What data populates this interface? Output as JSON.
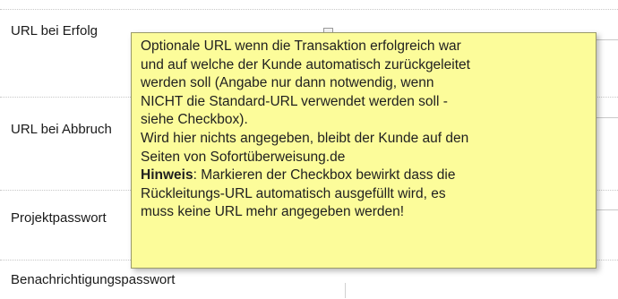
{
  "form": {
    "rows": [
      {
        "label": "URL bei Erfolg"
      },
      {
        "label": "URL bei Abbruch"
      },
      {
        "label": "Projektpasswort"
      },
      {
        "label": "Benachrichtigungspasswort"
      }
    ]
  },
  "tooltip": {
    "line1": "Optionale URL wenn die Transaktion erfolgreich war",
    "line2": "und auf welche der Kunde automatisch zurückgeleitet",
    "line3": "werden soll (Angabe nur dann notwendig, wenn",
    "line4": "NICHT die Standard-URL verwendet werden soll -",
    "line5": "siehe Checkbox).",
    "line6": "Wird hier nichts angegeben, bleibt der Kunde auf den",
    "line7": "Seiten von Sofortüberweisung.de",
    "hint_label": "Hinweis",
    "hint_rest": ": Markieren der Checkbox bewirkt dass die",
    "line9": "Rückleitungs-URL automatisch ausgefüllt wird, es",
    "line10": "muss keine URL mehr angegeben werden!"
  }
}
